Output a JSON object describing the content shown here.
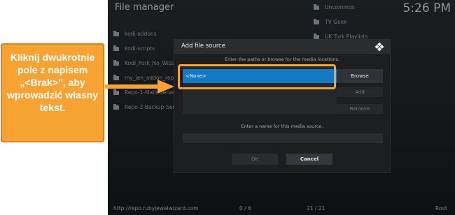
{
  "header": {
    "title": "File manager",
    "clock": "5:26 PM"
  },
  "left_list": [
    "kodi-addons",
    "kodi-scripts",
    "Kodi_Fork_No_Wizard",
    "my_jen_addon_repo",
    "Repo-1-Main-Server",
    "Repo-2-Backup-Server"
  ],
  "right_list": [
    "Uncommon",
    "TV Geek",
    "UK Turk Playlists"
  ],
  "footer": {
    "path": "http://repo.rubyjewelwizard.com",
    "left_count": "0 / 6",
    "right_count": "21 / 21",
    "root_label": "Root"
  },
  "dialog": {
    "title": "Add file source",
    "hint": "Enter the paths or browse for the media locations.",
    "path_value": "<None>",
    "browse_label": "Browse",
    "add_label": "Add",
    "remove_label": "Remove",
    "name_hint": "Enter a name for this media source.",
    "ok_label": "OK",
    "cancel_label": "Cancel"
  },
  "annotation": {
    "text": "Kliknij dwukrotnie pole z napisem „<Brak>”, aby wprowadzić własny tekst."
  },
  "colors": {
    "accent": "#f6a334",
    "selection": "#1479c4"
  }
}
